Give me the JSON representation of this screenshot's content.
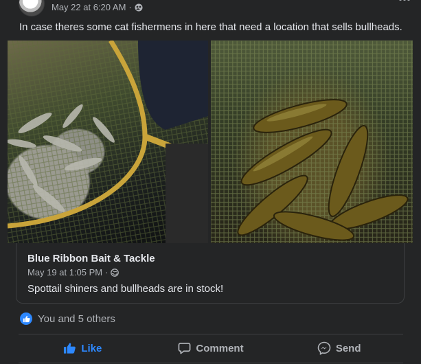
{
  "post": {
    "timestamp": "May 22 at 6:20 AM",
    "separator": "·",
    "caption": "In case theres some cat fishermens in here that need a location that sells bullheads."
  },
  "shared": {
    "page_name": "Blue Ribbon Bait & Tackle",
    "timestamp": "May 19 at 1:05 PM",
    "separator": "·",
    "text": "Spottail shiners and bullheads are in stock!"
  },
  "reactions": {
    "summary": "You and 5 others"
  },
  "actions": {
    "like": "Like",
    "comment": "Comment",
    "send": "Send"
  },
  "colors": {
    "accent": "#2d88ff",
    "background": "#242526",
    "text": "#e4e6eb",
    "muted": "#b0b3b8"
  },
  "icons": {
    "privacy": "friends-icon",
    "shared_privacy": "globe-icon",
    "like": "thumbs-up-icon",
    "comment": "comment-bubble-icon",
    "send": "messenger-icon"
  }
}
